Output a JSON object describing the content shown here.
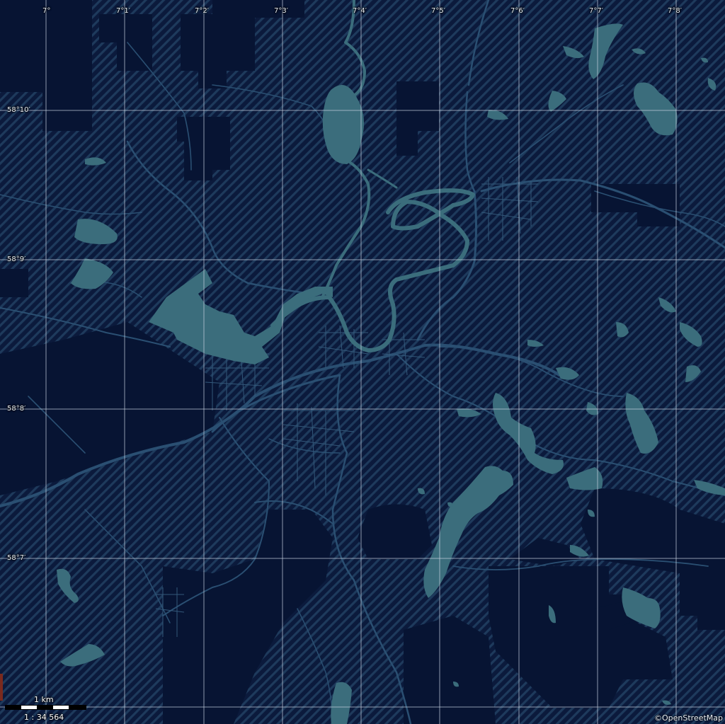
{
  "map": {
    "grid": {
      "longitudes": [
        "7°",
        "7°1′",
        "7°2′",
        "7°3′",
        "7°4′",
        "7°5′",
        "7°6′",
        "7°7′",
        "7°8′"
      ],
      "latitudes": [
        "58°10′",
        "58°9′",
        "58°8′",
        "58°7′"
      ]
    },
    "scale": {
      "distance_label": "1 km",
      "ratio_label": "1 : 34 564"
    },
    "attribution": "©OpenStreetMap",
    "colors": {
      "land": "#0b1a3c",
      "hatch": "#1f3a5c",
      "forest": "#071433",
      "water": "#3b6d7c",
      "road": "#2a4f72",
      "grid": "#c7d2e0"
    }
  }
}
